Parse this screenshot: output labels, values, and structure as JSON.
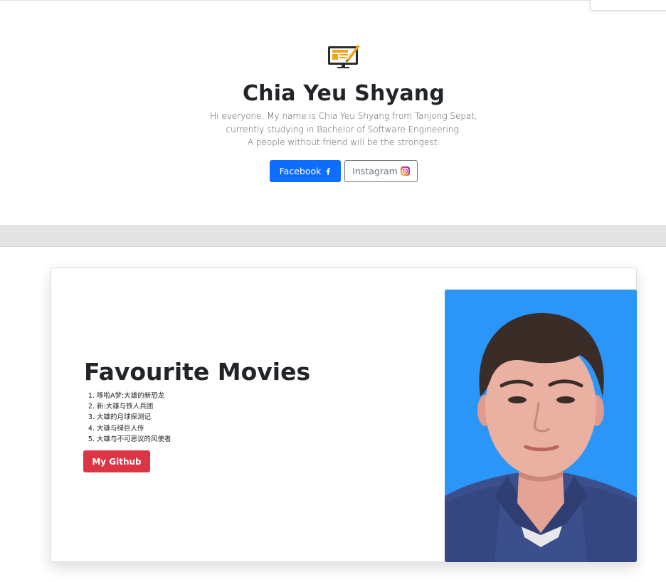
{
  "hero": {
    "icon": "monitor-pencil-icon",
    "name": "Chia Yeu Shyang",
    "bio_lines": [
      "Hi everyone, My name is Chia Yeu Shyang from Tanjong Sepat,",
      "currently studying in Bachelor of Software Engineering.",
      "A people without friend will be the strongest."
    ],
    "facebook_label": "Facebook",
    "facebook_icon": "facebook-icon",
    "instagram_label": "Instagram",
    "instagram_icon": "instagram-icon"
  },
  "movies": {
    "title": "Favourite Movies",
    "items": [
      "哆啦A梦:大雄的新恐龙",
      "新:大雄与铁人兵团",
      "大雄的月球探测记",
      "大雄与绿巨人传",
      "大雄与不可思议的风使者"
    ],
    "github_label": "My Github",
    "photo": "profile-photo"
  },
  "colors": {
    "primary": "#0d6efd",
    "danger": "#dc3545",
    "photo_background": "#2c95f8",
    "icon_accent": "#f2a417"
  }
}
